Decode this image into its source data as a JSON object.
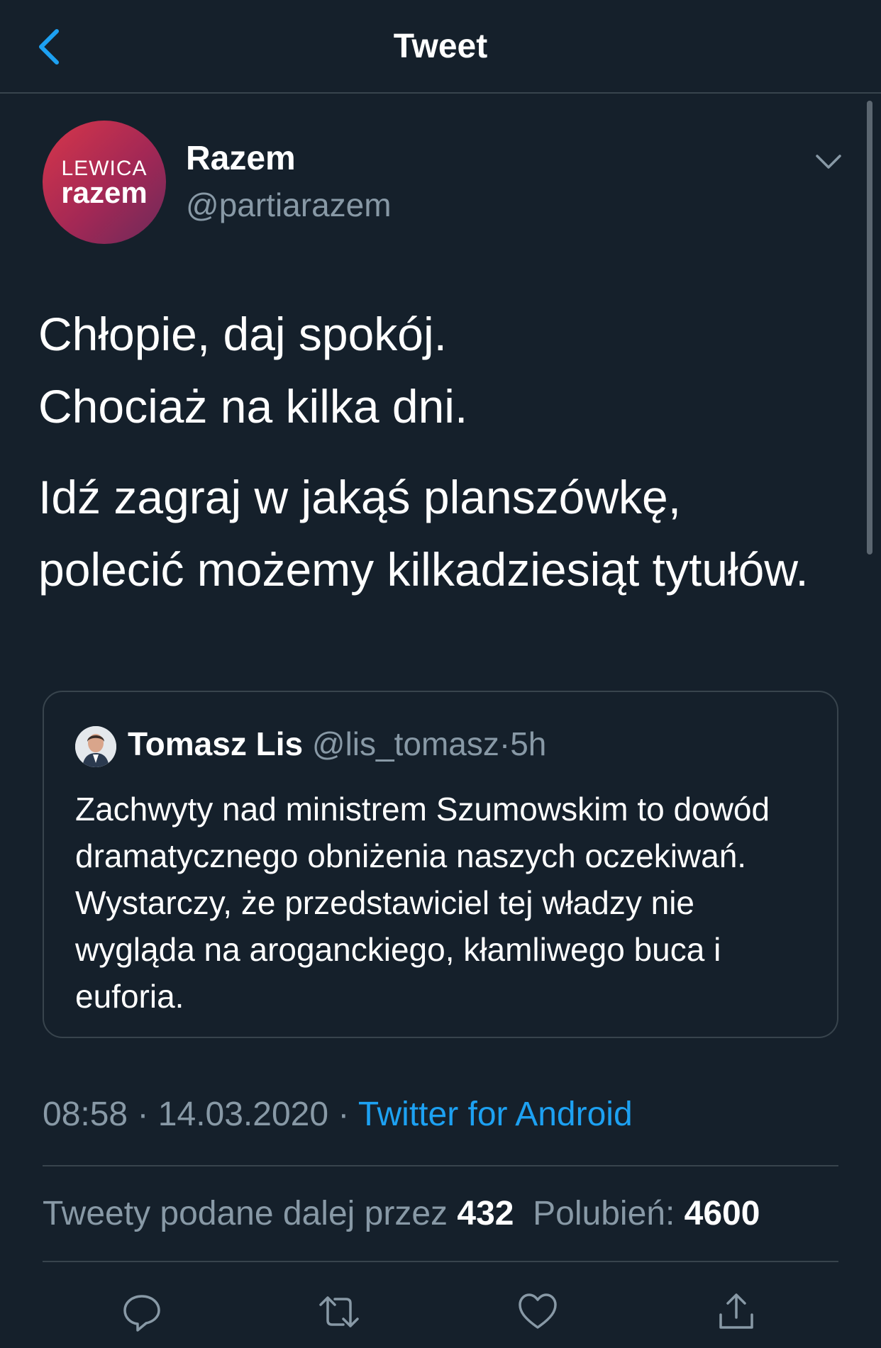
{
  "header": {
    "title": "Tweet"
  },
  "colors": {
    "background": "#15202b",
    "border": "#38444d",
    "secondary_text": "#8899a6",
    "accent": "#1da1f2"
  },
  "author": {
    "name": "Razem",
    "handle": "@partiarazem",
    "avatar_text_top": "LEWICA",
    "avatar_text_bottom": "razem"
  },
  "tweet": {
    "paragraphs": [
      [
        "Chłopie, daj spokój.",
        "Chociaż na kilka dni."
      ],
      [
        "Idź zagraj w jakąś planszówkę,",
        "polecić możemy kilkadziesiąt tytułów."
      ]
    ]
  },
  "quoted_tweet": {
    "name": "Tomasz Lis",
    "handle": "@lis_tomasz",
    "separator": "·",
    "time": "5h",
    "text": "Zachwyty nad ministrem Szumowskim to dowód dramatycznego obniżenia naszych oczekiwań. Wystarczy, że przedstawiciel  tej władzy nie wygląda na aroganckiego, kłamliwego buca i euforia."
  },
  "meta": {
    "time": "08:58",
    "date": "14.03.2020",
    "separator": "·",
    "source": "Twitter for Android"
  },
  "stats": {
    "retweets_label": "Tweety podane dalej przez",
    "retweets_count": "432",
    "likes_label": "Polubień:",
    "likes_count": "4600"
  },
  "actions": {
    "icons": [
      "reply-icon",
      "retweet-icon",
      "like-icon",
      "share-icon"
    ]
  }
}
